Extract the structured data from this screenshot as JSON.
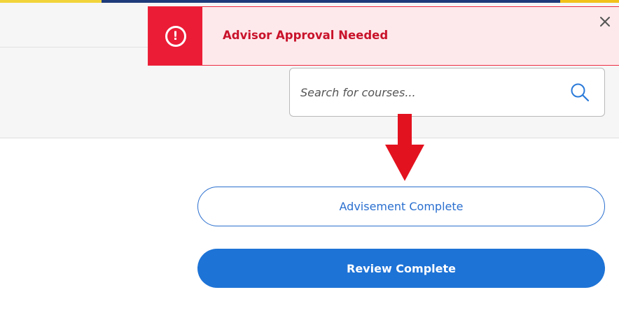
{
  "colors": {
    "alert_accent": "#eb1c36",
    "alert_background": "#fde9eb",
    "alert_text": "#c9132b",
    "primary_blue": "#1e73d6",
    "annotation_arrow": "#e3121f"
  },
  "alert": {
    "icon": "exclamation-circle-icon",
    "title": "Advisor Approval Needed",
    "close_icon": "close-icon"
  },
  "search": {
    "placeholder": "Search for courses...",
    "value": "",
    "icon": "search-icon"
  },
  "annotation": {
    "icon": "down-arrow-icon"
  },
  "actions": {
    "advisement_complete_label": "Advisement Complete",
    "review_complete_label": "Review Complete"
  }
}
